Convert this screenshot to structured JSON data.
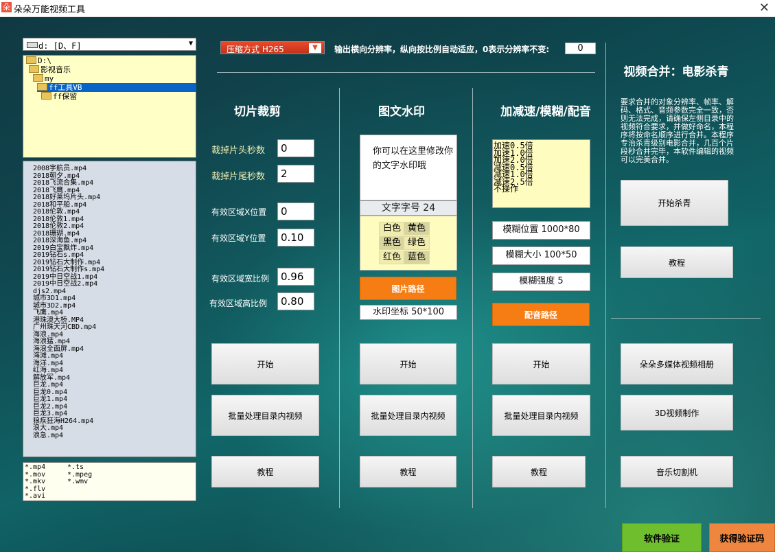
{
  "window": {
    "title": "朵朵万能视频工具",
    "icon_char": "朵"
  },
  "drive": {
    "selected": "d: [D、F]"
  },
  "folder_tree": [
    {
      "label": "D:\\",
      "selected": false
    },
    {
      "label": "影视音乐",
      "selected": false
    },
    {
      "label": "my",
      "selected": false
    },
    {
      "label": "ff工具VB",
      "selected": true
    },
    {
      "label": "ff保留",
      "selected": false
    }
  ],
  "files": [
    "2008宇航员.mp4",
    "2018朝夕.mp4",
    "2018飞流合集.mp4",
    "2018飞鹰.mp4",
    "2018好莱坞片头.mp4",
    "2018和平船.mp4",
    "2018伦敦.mp4",
    "2018伦敦1.mp4",
    "2018伦敦2.mp4",
    "2018珊瑚.mp4",
    "2018深海鱼.mp4",
    "2019白宝飘炸.mp4",
    "2019钻石s.mp4",
    "2019钻石大制作.mp4",
    "2019钻石大制作s.mp4",
    "2019中日空战1.mp4",
    "2019中日空战2.mp4",
    "djs2.mp4",
    "城市3D1.mp4",
    "城市3D2.mp4",
    "飞鹰.mp4",
    "港珠澳大桥.MP4",
    "广州珠天河CBD.mp4",
    "海浪.mp4",
    "海浪猛.mp4",
    "海浪全面屏.mp4",
    "海滩.mp4",
    "海洋.mp4",
    "红海.mp4",
    "解放军.mp4",
    "巨龙.mp4",
    "巨龙0.mp4",
    "巨龙1.mp4",
    "巨龙2.mp4",
    "巨龙3.mp4",
    "狼疾狂海H264.mp4",
    "浪大.mp4",
    "浪急.mp4"
  ],
  "filters": {
    "col1": [
      "*.mp4",
      "*.mov",
      "*.mkv",
      "*.flv",
      "*.avi"
    ],
    "col2": [
      "*.ts",
      "*.mpeg",
      "*.wmv"
    ]
  },
  "compression": {
    "label": "压缩方式 H265",
    "arrow": "▼"
  },
  "resolution": {
    "label": "输出横向分辨率，纵向按比例自动适应，0表示分辨率不变:",
    "value": "0"
  },
  "cut": {
    "title": "切片裁剪",
    "head_label": "裁掉片头秒数",
    "head_value": "0",
    "tail_label": "裁掉片尾秒数",
    "tail_value": "2",
    "x_label": "有效区域X位置",
    "x_value": "0",
    "y_label": "有效区域Y位置",
    "y_value": "0.10",
    "w_label": "有效区域宽比例",
    "w_value": "0.96",
    "h_label": "有效区域高比例",
    "h_value": "0.80",
    "start": "开始",
    "batch": "批量处理目录内视频",
    "tutorial": "教程"
  },
  "watermark": {
    "title": "图文水印",
    "text": "你可以在这里修改你的文字水印哦",
    "font_size": "文字字号 24",
    "colors": [
      [
        "白色",
        "黄色"
      ],
      [
        "黑色",
        "绿色"
      ],
      [
        "红色",
        "蓝色"
      ]
    ],
    "image_path": "图片路径",
    "coords": "水印坐标 50*100",
    "start": "开始",
    "batch": "批量处理目录内视频",
    "tutorial": "教程"
  },
  "speed": {
    "title": "加减速/模糊/配音",
    "options": [
      "加速0.5倍",
      "加速1.0倍",
      "加速2.0倍",
      "减速0.5倍",
      "减速1.0倍",
      "减速2.5倍",
      "不操作"
    ],
    "blur_pos": "模糊位置 1000*80",
    "blur_size": "模糊大小 100*50",
    "blur_strength": "模糊强度 5",
    "audio_path": "配音路径",
    "start": "开始",
    "batch": "批量处理目录内视频",
    "tutorial": "教程"
  },
  "merge": {
    "title": "视频合并：电影杀青",
    "desc": "要求合并的对象分辨率、帧率、解码、格式、音频参数完全一致，否则无法完成，请确保左侧目录中的视频符合要求，并做好命名，本程序将按命名顺序进行合并。本程序专治杀青级别电影合并，几百个片段秒合并完毕，本软件编辑的视频可以完美合并。",
    "start": "开始杀青",
    "tutorial": "教程",
    "album": "朵朵多媒体视频相册",
    "video3d": "3D视频制作",
    "music_cut": "音乐切割机"
  },
  "footer": {
    "verify": "软件验证",
    "get_code": "获得验证码"
  },
  "colors": {
    "orange": "#f57d13",
    "green": "#6fbe2e",
    "compress_red": "#e84a2a",
    "selected_blue": "#0a64c8"
  }
}
